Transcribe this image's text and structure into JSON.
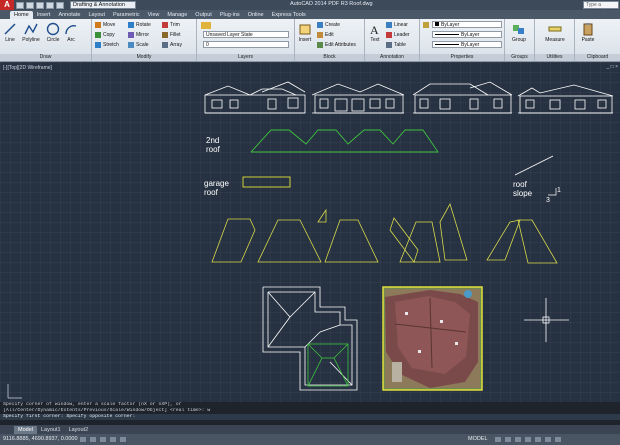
{
  "titlebar": {
    "logo": "A",
    "workspace": "Drafting & Annotation",
    "doc_title": "AutoCAD 2014  PDF R3 Roof.dwg",
    "search_placeholder": "Type a keyword"
  },
  "tabs": [
    "Home",
    "Insert",
    "Annotate",
    "Layout",
    "Parametric",
    "View",
    "Manage",
    "Output",
    "Plug-ins",
    "Online",
    "Express Tools"
  ],
  "ribbon": {
    "draw": {
      "title": "Draw",
      "line": "Line",
      "polyline": "Polyline",
      "circle": "Circle",
      "arc": "Arc"
    },
    "modify": {
      "title": "Modify",
      "move": "Move",
      "rotate": "Rotate",
      "trim": "Trim",
      "copy": "Copy",
      "mirror": "Mirror",
      "fillet": "Fillet",
      "stretch": "Stretch",
      "scale": "Scale",
      "array": "Array"
    },
    "layers": {
      "title": "Layers",
      "state": "Unsaved Layer State",
      "current": "0"
    },
    "block": {
      "title": "Block",
      "insert": "Insert",
      "create": "Create",
      "edit": "Edit",
      "edit_attributes": "Edit Attributes"
    },
    "annotation": {
      "title": "Annotation",
      "text": "Text",
      "linear": "Linear",
      "leader": "Leader",
      "table": "Table"
    },
    "properties": {
      "title": "Properties",
      "color": "ByLayer",
      "linetype": "ByLayer",
      "lineweight": "ByLayer"
    },
    "groups": {
      "title": "Groups",
      "group": "Group"
    },
    "utilities": {
      "title": "Utilities",
      "measure": "Measure"
    },
    "clipboard": {
      "title": "Clipboard",
      "paste": "Paste"
    }
  },
  "viewport": {
    "label": "[-][Top][2D Wireframe]",
    "controls": "_ □ ×",
    "labels": {
      "second_roof": "2nd\nroof",
      "garage_roof": "garage\nroof",
      "roof_slope": "roof\nslope",
      "slope_rise": "1",
      "slope_run": "3"
    },
    "colors": {
      "linework": "#ffffff",
      "roof": "#3ec43e",
      "sections": "#d7d94a",
      "box": "#e2e03c"
    }
  },
  "command": {
    "lines": [
      "Specify corner of window, enter a scale factor (nX or nXP), or",
      "[All/Center/Dynamic/Extents/Previous/Scale/Window/Object] <real time>: w",
      "Specify first corner: Specify opposite corner:"
    ]
  },
  "layout_tabs": [
    "Model",
    "Layout1",
    "Layout2"
  ],
  "status": {
    "coords": "9116.8885, 4690.8937, 0.0000",
    "model": "MODEL"
  }
}
